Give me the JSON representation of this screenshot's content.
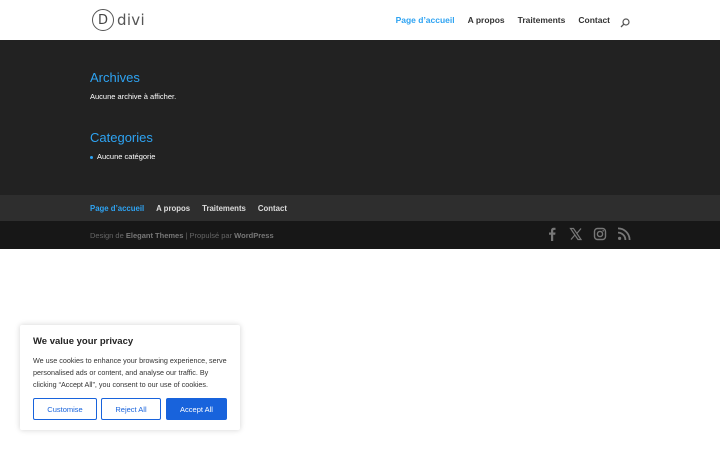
{
  "logo": {
    "mark": "D",
    "text": "divi"
  },
  "top_nav": {
    "items": [
      {
        "label": "Page d’accueil",
        "active": true
      },
      {
        "label": "A propos",
        "active": false
      },
      {
        "label": "Traitements",
        "active": false
      },
      {
        "label": "Contact",
        "active": false
      }
    ],
    "search_icon": "search-icon"
  },
  "widgets": {
    "archives": {
      "title": "Archives",
      "text": "Aucune archive à afficher."
    },
    "categories": {
      "title": "Categories",
      "item": "Aucune catégorie"
    }
  },
  "footer_nav": {
    "items": [
      {
        "label": "Page d’accueil",
        "active": true
      },
      {
        "label": "A propos",
        "active": false
      },
      {
        "label": "Traitements",
        "active": false
      },
      {
        "label": "Contact",
        "active": false
      }
    ]
  },
  "footer_credits": {
    "design_prefix": "Design de",
    "design_link": "Elegant Themes",
    "separator": "|",
    "powered_prefix": "Propulsé par",
    "powered_link": "WordPress"
  },
  "social_icons": [
    "facebook-icon",
    "x-icon",
    "instagram-icon",
    "rss-icon"
  ],
  "cookie_banner": {
    "title": "We value your privacy",
    "text": "We use cookies to enhance your browsing experience, serve personalised ads or content, and analyse our traffic. By clicking “Accept All”, you consent to our use of cookies.",
    "customise_label": "Customise",
    "reject_label": "Reject All",
    "accept_label": "Accept All"
  },
  "colors": {
    "accent": "#2ea3f2",
    "widget_bg": "#222222",
    "footer_nav_bg": "#2e2e2e",
    "footer_bottom_bg": "#171717",
    "cookie_button": "#1863dc"
  }
}
